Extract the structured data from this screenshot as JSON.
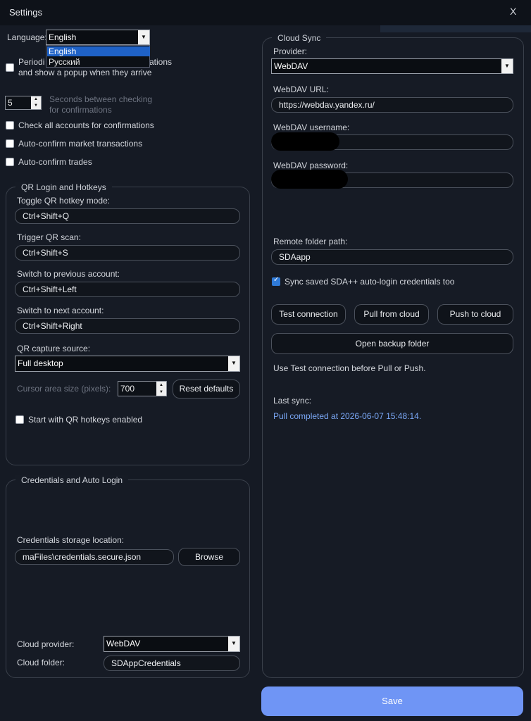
{
  "window": {
    "title": "Settings",
    "close": "X"
  },
  "general": {
    "language_label": "Language:",
    "language_value": "English",
    "language_options": [
      "English",
      "Русский"
    ],
    "periodic_label_visible": "Periodi",
    "periodic_label_tail": "ations",
    "periodic_label_line2": "and show a popup when they arrive",
    "seconds_value": "5",
    "seconds_label": "Seconds between checking\nfor confirmations",
    "seconds_label_1": "Seconds between checking",
    "seconds_label_2": "for confirmations",
    "check_all_label": "Check all accounts for confirmations",
    "auto_market_label": "Auto-confirm market transactions",
    "auto_trades_label": "Auto-confirm trades"
  },
  "qr": {
    "group_title": "QR Login and Hotkeys",
    "toggle_label": "Toggle QR hotkey mode:",
    "toggle_value": "Ctrl+Shift+Q",
    "trigger_label": "Trigger QR scan:",
    "trigger_value": "Ctrl+Shift+S",
    "prev_label": "Switch to previous account:",
    "prev_value": "Ctrl+Shift+Left",
    "next_label": "Switch to next account:",
    "next_value": "Ctrl+Shift+Right",
    "capture_label": "QR capture source:",
    "capture_value": "Full desktop",
    "cursor_label": "Cursor area size (pixels):",
    "cursor_value": "700",
    "reset_label": "Reset defaults",
    "start_label": "Start with QR hotkeys enabled"
  },
  "credentials": {
    "group_title": "Credentials and Auto Login",
    "storage_label": "Credentials storage location:",
    "storage_value": "maFiles\\credentials.secure.json",
    "browse_label": "Browse",
    "cloud_provider_label": "Cloud provider:",
    "cloud_provider_value": "WebDAV",
    "cloud_folder_label": "Cloud folder:",
    "cloud_folder_value": "SDAppCredentials"
  },
  "cloud": {
    "group_title": "Cloud Sync",
    "provider_label": "Provider:",
    "provider_value": "WebDAV",
    "url_label": "WebDAV URL:",
    "url_value": "https://webdav.yandex.ru/",
    "username_label": "WebDAV username:",
    "password_label": "WebDAV password:",
    "remote_label": "Remote folder path:",
    "remote_value": "SDAapp",
    "sync_label": "Sync saved SDA++ auto-login credentials too",
    "test_label": "Test connection",
    "pull_label": "Pull from cloud",
    "push_label": "Push to cloud",
    "open_backup_label": "Open backup folder",
    "hint": "Use Test connection before Pull or Push.",
    "last_sync_label": "Last sync:",
    "last_sync_value": "Pull completed at 2026-06-07 15:48:14."
  },
  "footer": {
    "save_label": "Save"
  },
  "colors": {
    "accent": "#6f95f5",
    "link": "#7aa7f5",
    "background": "#151a24"
  }
}
